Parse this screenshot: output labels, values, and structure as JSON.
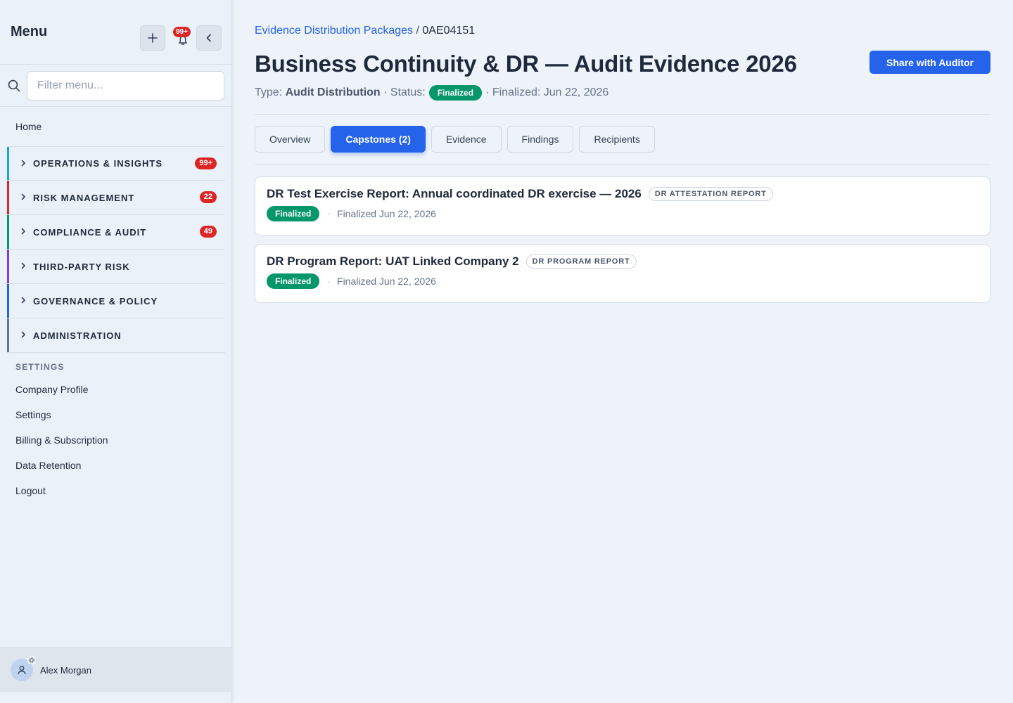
{
  "sidebar": {
    "title": "Menu",
    "notification_badge": "99+",
    "filter_placeholder": "Filter menu...",
    "home": "Home",
    "groups": [
      {
        "label": "OPERATIONS & INSIGHTS",
        "badge": "99+",
        "color": "#0ea5e9"
      },
      {
        "label": "RISK MANAGEMENT",
        "badge": "22",
        "color": "#dc2626"
      },
      {
        "label": "COMPLIANCE & AUDIT",
        "badge": "49",
        "color": "#059669"
      },
      {
        "label": "THIRD-PARTY RISK",
        "badge": "",
        "color": "#7c3aed"
      },
      {
        "label": "GOVERNANCE & POLICY",
        "badge": "",
        "color": "#2563eb"
      },
      {
        "label": "ADMINISTRATION",
        "badge": "",
        "color": "#64748b"
      }
    ],
    "settings_heading": "SETTINGS",
    "settings_items": [
      "Company Profile",
      "Settings",
      "Billing & Subscription",
      "Data Retention",
      "Logout"
    ],
    "user_name": "Alex Morgan"
  },
  "breadcrumb": {
    "parent": "Evidence Distribution Packages",
    "separator": "/",
    "current": "0AE04151"
  },
  "page": {
    "title": "Business Continuity & DR — Audit Evidence 2026",
    "share_button": "Share with Auditor",
    "type_label": "Type:",
    "type_value": "Audit Distribution",
    "status_label": "· Status:",
    "status_value": "Finalized",
    "finalized_text": "· Finalized: Jun 22, 2026"
  },
  "tabs": [
    {
      "label": "Overview",
      "active": false
    },
    {
      "label": "Capstones (2)",
      "active": true
    },
    {
      "label": "Evidence",
      "active": false
    },
    {
      "label": "Findings",
      "active": false
    },
    {
      "label": "Recipients",
      "active": false
    }
  ],
  "capstones": [
    {
      "title": "DR Test Exercise Report: Annual coordinated DR exercise — 2026",
      "tag": "DR ATTESTATION REPORT",
      "status": "Finalized",
      "separator": "·",
      "date": "Finalized Jun 22, 2026"
    },
    {
      "title": "DR Program Report: UAT Linked Company 2",
      "tag": "DR PROGRAM REPORT",
      "status": "Finalized",
      "separator": "·",
      "date": "Finalized Jun 22, 2026"
    }
  ],
  "colors": {
    "accent": "#2563eb",
    "success": "#059669",
    "danger": "#dc2626"
  }
}
